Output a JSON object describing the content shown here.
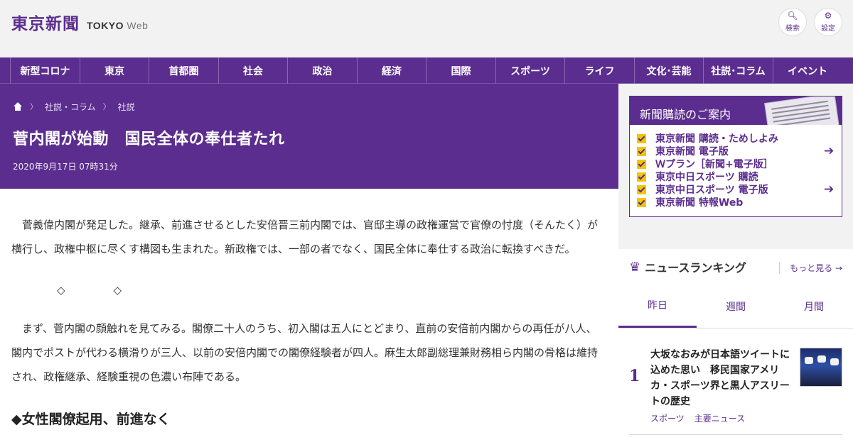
{
  "site": {
    "logo_jp": "東京新聞",
    "logo_en_bold": "TOKYO",
    "logo_en_light": "Web"
  },
  "header_buttons": {
    "search_label": "検索",
    "settings_label": "設定"
  },
  "nav": {
    "items": [
      "新型コロナ",
      "東京",
      "首都圏",
      "社会",
      "政治",
      "経済",
      "国際",
      "スポーツ",
      "ライフ",
      "文化･芸能",
      "社説･コラム",
      "イベント"
    ]
  },
  "breadcrumb": {
    "items": [
      "社説・コラム",
      "社説"
    ]
  },
  "article": {
    "title": "菅内閣が始動　国民全体の奉仕者たれ",
    "date": "2020年9月17日 07時31分",
    "paragraphs": [
      "菅義偉内閣が発足した。継承、前進させるとした安倍晋三前内閣では、官邸主導の政権運営で官僚の忖度（そんたく）が横行し、政権中枢に尽くす構図も生まれた。新政権では、一部の者でなく、国民全体に奉仕する政治に転換すべきだ。",
      "まず、菅内閣の顔触れを見てみる。閣僚二十人のうち、初入閣は五人にとどまり、直前の安倍前内閣からの再任が八人、閣内でポストが代わる横滑りが三人、以前の安倍内閣での閣僚経験者が四人。麻生太郎副総理兼財務相ら内閣の骨格は維持され、政権継承、経験重視の色濃い布陣である。"
    ],
    "divider": [
      "◇",
      "◇"
    ],
    "subheading": "◆女性閣僚起用、前進なく"
  },
  "subscription": {
    "title": "新聞購読のご案内",
    "items": [
      "東京新聞 購読・ためしよみ",
      "東京新聞 電子版",
      "Ｗプラン［新聞+電子版］",
      "東京中日スポーツ 購読",
      "東京中日スポーツ 電子版",
      "東京新聞 特報Web"
    ]
  },
  "ranking": {
    "title": "ニュースランキング",
    "more": "もっと見る",
    "tabs": [
      "昨日",
      "週間",
      "月間"
    ],
    "items": [
      {
        "rank": "1",
        "title": "大坂なおみが日本語ツイートに込めた思い　移民国家アメリカ・スポーツ界と黒人アスリートの歴史",
        "tags": [
          "スポーツ",
          "主要ニュース"
        ]
      }
    ]
  },
  "colors": {
    "brand_purple": "#5b2d8e",
    "check_yellow": "#f3c400"
  }
}
